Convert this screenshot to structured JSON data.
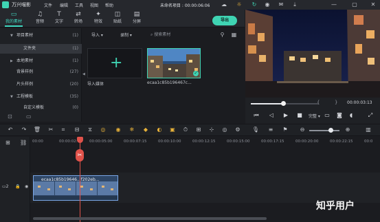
{
  "app": {
    "name": "万兴喵影",
    "menu": [
      "文件",
      "编辑",
      "工具",
      "视图",
      "帮助"
    ],
    "project_title": "未命名项目 : 00:00:06:06",
    "colors": {
      "accent": "#3fd4b3",
      "playhead": "#e0524a",
      "clip_border": "#7aa7e8",
      "gold_icon": "#e8b23a"
    }
  },
  "tabs": [
    {
      "label": "我的素材",
      "icon": "folder-icon"
    },
    {
      "label": "音频",
      "icon": "music-icon"
    },
    {
      "label": "文字",
      "icon": "text-icon"
    },
    {
      "label": "转场",
      "icon": "transition-icon"
    },
    {
      "label": "特效",
      "icon": "effects-icon"
    },
    {
      "label": "贴纸",
      "icon": "sticker-icon"
    },
    {
      "label": "分屏",
      "icon": "split-screen-icon"
    }
  ],
  "export_label": "导出",
  "sidebar": {
    "items": [
      {
        "label": "项目素材",
        "count": "(1)"
      },
      {
        "label": "文件夹",
        "count": "(1)"
      },
      {
        "label": "本地素材",
        "count": "(1)"
      },
      {
        "label": "背景样例",
        "count": "(27)"
      },
      {
        "label": "片头样例",
        "count": "(20)"
      },
      {
        "label": "工程模板",
        "count": "(35)"
      },
      {
        "label": "自定义模板",
        "count": "(0)"
      }
    ]
  },
  "media": {
    "import_dropdown": "导入",
    "record_dropdown": "录制",
    "search_placeholder": "搜索素材",
    "import_label": "导入媒体",
    "clip_name": "ecaa1c85b196467c..."
  },
  "preview": {
    "timecode": "00:00:03:13",
    "quality": "完整"
  },
  "timeline": {
    "ticks": [
      "00:00",
      "00:00:02:15",
      "00:00:05:00",
      "00:00:07:15",
      "00:00:10:00",
      "00:00:12:15",
      "00:00:15:00",
      "00:00:17:15",
      "00:00:20:00",
      "00:00:22:15",
      "00:0"
    ],
    "clip_title": "ecaa1c85b19646...f202eb...",
    "track_label": "2"
  },
  "watermark": "知乎用户"
}
